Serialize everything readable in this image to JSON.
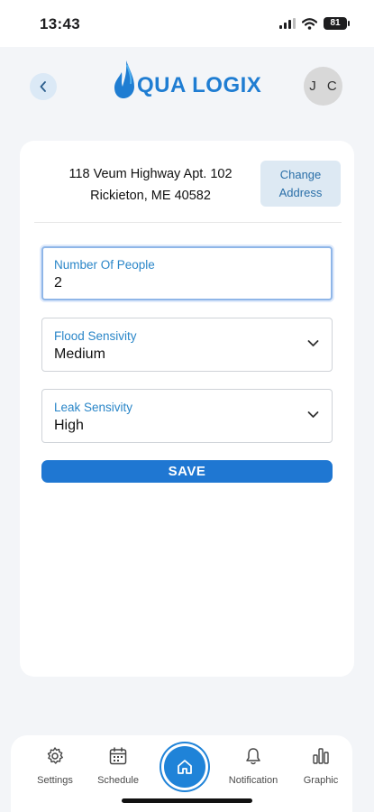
{
  "status_bar": {
    "time": "13:43",
    "battery": "81"
  },
  "header": {
    "logo_text": "QUA LOGIX",
    "avatar_initials": "J C"
  },
  "address": {
    "line1": "118 Veum Highway Apt. 102",
    "line2": "Rickieton, ME 40582",
    "change_label_1": "Change",
    "change_label_2": "Address"
  },
  "form": {
    "people": {
      "label": "Number Of People",
      "value": "2"
    },
    "flood": {
      "label": "Flood Sensivity",
      "value": "Medium"
    },
    "leak": {
      "label": "Leak Sensivity",
      "value": "High"
    },
    "save_label": "SAVE"
  },
  "nav": {
    "settings": "Settings",
    "schedule": "Schedule",
    "notification": "Notification",
    "graphic": "Graphic"
  },
  "colors": {
    "accent": "#1f77d2",
    "background": "#f3f5f8"
  }
}
